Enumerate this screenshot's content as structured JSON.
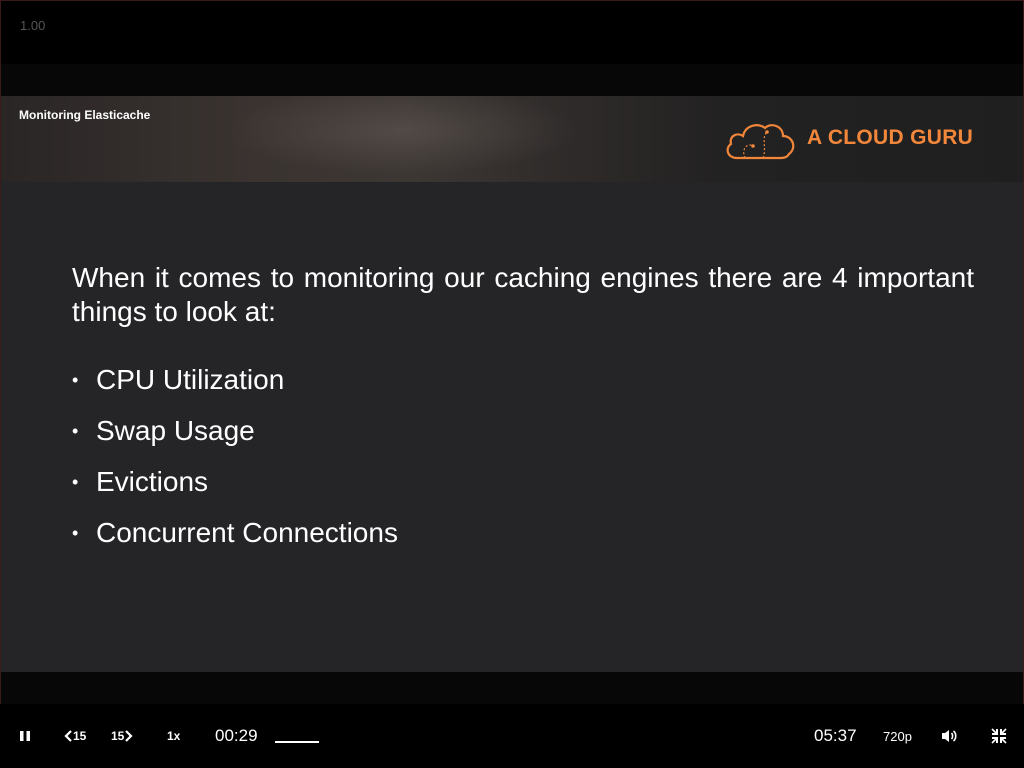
{
  "player": {
    "speed_indicator": "1.00",
    "controls": {
      "skip_back_label": "15",
      "skip_forward_label": "15",
      "playback_rate": "1x",
      "current_time": "00:29",
      "duration": "05:37",
      "quality": "720p",
      "progress_fraction": 0.086
    }
  },
  "slide": {
    "course_title": "Monitoring Elasticache",
    "brand": "A CLOUD GURU",
    "brand_color": "#f2873b",
    "lead_text": "When it comes to monitoring our caching engines there are 4 important things to look at:",
    "bullets": [
      "CPU Utilization",
      "Swap Usage",
      "Evictions",
      "Concurrent Connections"
    ]
  }
}
